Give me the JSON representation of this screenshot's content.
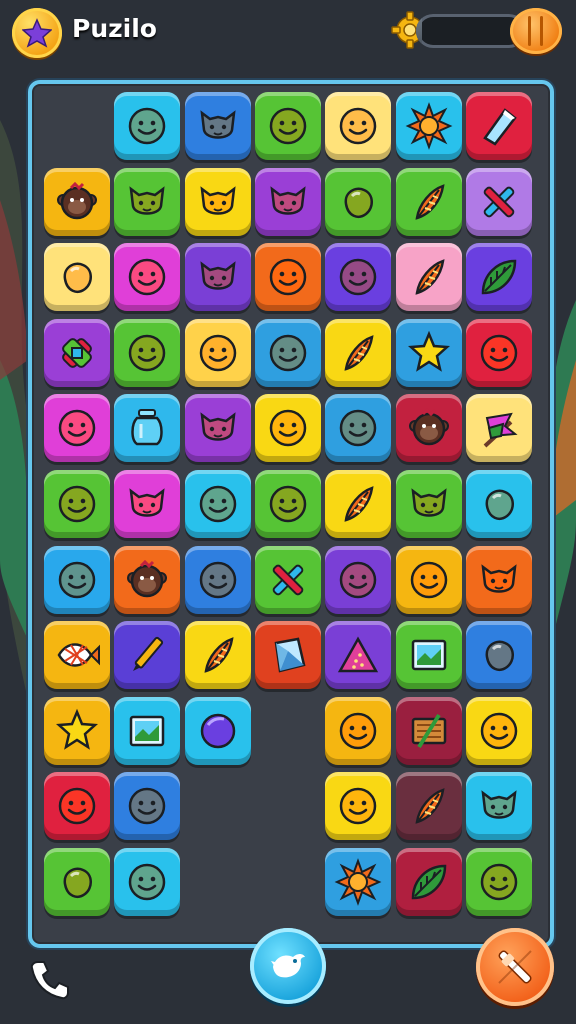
{
  "app": {
    "title": "Puzilo"
  },
  "header": {
    "progress_fraction": 0.05
  },
  "colors": {
    "background": "#2b3038",
    "board_border": "#66c7ee",
    "board_fill": "#3a3f48"
  },
  "bottom_bar": {
    "left_icon": "phone-icon",
    "center_icon": "bird-icon",
    "right_icon": "crossed-tools-icon"
  },
  "board": {
    "columns": 7,
    "rows": 11,
    "tiles": [
      {
        "row": 0,
        "col": 1,
        "color": "#29c1ec",
        "icon": "smiley"
      },
      {
        "row": 0,
        "col": 2,
        "color": "#2f7fe0",
        "icon": "cat"
      },
      {
        "row": 0,
        "col": 3,
        "color": "#56c435",
        "icon": "smiley"
      },
      {
        "row": 0,
        "col": 4,
        "color": "#ffe27a",
        "icon": "smiley"
      },
      {
        "row": 0,
        "col": 5,
        "color": "#29c1ec",
        "icon": "sun"
      },
      {
        "row": 0,
        "col": 6,
        "color": "#e0213f",
        "icon": "crystal"
      },
      {
        "row": 1,
        "col": 0,
        "color": "#f5b611",
        "icon": "monkey"
      },
      {
        "row": 1,
        "col": 1,
        "color": "#56c435",
        "icon": "cat"
      },
      {
        "row": 1,
        "col": 2,
        "color": "#f9d814",
        "icon": "cat"
      },
      {
        "row": 1,
        "col": 3,
        "color": "#9a3fd6",
        "icon": "cat"
      },
      {
        "row": 1,
        "col": 4,
        "color": "#56c435",
        "icon": "blob"
      },
      {
        "row": 1,
        "col": 5,
        "color": "#56c435",
        "icon": "feather"
      },
      {
        "row": 1,
        "col": 6,
        "color": "#b07ae6",
        "icon": "cross"
      },
      {
        "row": 2,
        "col": 0,
        "color": "#ffe27a",
        "icon": "blob"
      },
      {
        "row": 2,
        "col": 1,
        "color": "#e03fd8",
        "icon": "smiley"
      },
      {
        "row": 2,
        "col": 2,
        "color": "#7a3fd6",
        "icon": "cat"
      },
      {
        "row": 2,
        "col": 3,
        "color": "#f26a1b",
        "icon": "smiley"
      },
      {
        "row": 2,
        "col": 4,
        "color": "#6a3fe0",
        "icon": "smiley"
      },
      {
        "row": 2,
        "col": 5,
        "color": "#f7a3c7",
        "icon": "feather"
      },
      {
        "row": 2,
        "col": 6,
        "color": "#6a3fe0",
        "icon": "leaf"
      },
      {
        "row": 3,
        "col": 0,
        "color": "#9a3fd6",
        "icon": "candy"
      },
      {
        "row": 3,
        "col": 1,
        "color": "#56c435",
        "icon": "smiley"
      },
      {
        "row": 3,
        "col": 2,
        "color": "#ffd24a",
        "icon": "smiley"
      },
      {
        "row": 3,
        "col": 3,
        "color": "#2f9fe0",
        "icon": "smiley"
      },
      {
        "row": 3,
        "col": 4,
        "color": "#f9d814",
        "icon": "feather"
      },
      {
        "row": 3,
        "col": 5,
        "color": "#2f9fe0",
        "icon": "star"
      },
      {
        "row": 3,
        "col": 6,
        "color": "#e0213f",
        "icon": "smiley"
      },
      {
        "row": 4,
        "col": 0,
        "color": "#e03fd8",
        "icon": "smiley"
      },
      {
        "row": 4,
        "col": 1,
        "color": "#2fb8ec",
        "icon": "jar"
      },
      {
        "row": 4,
        "col": 2,
        "color": "#9a3fd6",
        "icon": "cat"
      },
      {
        "row": 4,
        "col": 3,
        "color": "#f9d814",
        "icon": "smiley"
      },
      {
        "row": 4,
        "col": 4,
        "color": "#2f9fe0",
        "icon": "smiley"
      },
      {
        "row": 4,
        "col": 5,
        "color": "#c2213f",
        "icon": "monkey"
      },
      {
        "row": 4,
        "col": 6,
        "color": "#ffe27a",
        "icon": "flag"
      },
      {
        "row": 5,
        "col": 0,
        "color": "#56c435",
        "icon": "smiley"
      },
      {
        "row": 5,
        "col": 1,
        "color": "#e03fd8",
        "icon": "cat"
      },
      {
        "row": 5,
        "col": 2,
        "color": "#29c1ec",
        "icon": "smiley"
      },
      {
        "row": 5,
        "col": 3,
        "color": "#56c435",
        "icon": "smiley"
      },
      {
        "row": 5,
        "col": 4,
        "color": "#f9d814",
        "icon": "feather"
      },
      {
        "row": 5,
        "col": 5,
        "color": "#56c435",
        "icon": "cat"
      },
      {
        "row": 5,
        "col": 6,
        "color": "#29c1ec",
        "icon": "blob"
      },
      {
        "row": 6,
        "col": 0,
        "color": "#29a8ec",
        "icon": "smiley"
      },
      {
        "row": 6,
        "col": 1,
        "color": "#f26a1b",
        "icon": "monkey"
      },
      {
        "row": 6,
        "col": 2,
        "color": "#2f7fe0",
        "icon": "smiley"
      },
      {
        "row": 6,
        "col": 3,
        "color": "#56c435",
        "icon": "cross"
      },
      {
        "row": 6,
        "col": 4,
        "color": "#7a3fd6",
        "icon": "smiley"
      },
      {
        "row": 6,
        "col": 5,
        "color": "#f5b611",
        "icon": "smiley"
      },
      {
        "row": 6,
        "col": 6,
        "color": "#f26a1b",
        "icon": "cat"
      },
      {
        "row": 7,
        "col": 0,
        "color": "#f5b611",
        "icon": "fish"
      },
      {
        "row": 7,
        "col": 1,
        "color": "#5a3fd6",
        "icon": "pencil"
      },
      {
        "row": 7,
        "col": 2,
        "color": "#f9d814",
        "icon": "feather"
      },
      {
        "row": 7,
        "col": 3,
        "color": "#e0411f",
        "icon": "gem"
      },
      {
        "row": 7,
        "col": 4,
        "color": "#7a3fd6",
        "icon": "triangle"
      },
      {
        "row": 7,
        "col": 5,
        "color": "#56c435",
        "icon": "picture"
      },
      {
        "row": 7,
        "col": 6,
        "color": "#2f7fe0",
        "icon": "blob"
      },
      {
        "row": 8,
        "col": 0,
        "color": "#f5b611",
        "icon": "star"
      },
      {
        "row": 8,
        "col": 1,
        "color": "#29c1ec",
        "icon": "picture"
      },
      {
        "row": 8,
        "col": 2,
        "color": "#29c1ec",
        "icon": "ball"
      },
      {
        "row": 8,
        "col": 4,
        "color": "#f5b611",
        "icon": "smiley"
      },
      {
        "row": 8,
        "col": 5,
        "color": "#9a1f3f",
        "icon": "sign"
      },
      {
        "row": 8,
        "col": 6,
        "color": "#f9d814",
        "icon": "smiley"
      },
      {
        "row": 9,
        "col": 0,
        "color": "#e0213f",
        "icon": "smiley"
      },
      {
        "row": 9,
        "col": 1,
        "color": "#2f7fe0",
        "icon": "smiley"
      },
      {
        "row": 9,
        "col": 4,
        "color": "#f9d814",
        "icon": "smiley"
      },
      {
        "row": 9,
        "col": 5,
        "color": "#6a2f3f",
        "icon": "feather"
      },
      {
        "row": 9,
        "col": 6,
        "color": "#29c1ec",
        "icon": "cat"
      },
      {
        "row": 10,
        "col": 0,
        "color": "#56c435",
        "icon": "blob"
      },
      {
        "row": 10,
        "col": 1,
        "color": "#29c1ec",
        "icon": "smiley"
      },
      {
        "row": 10,
        "col": 4,
        "color": "#2f9fe0",
        "icon": "sun"
      },
      {
        "row": 10,
        "col": 5,
        "color": "#b01f3f",
        "icon": "leaf"
      },
      {
        "row": 10,
        "col": 6,
        "color": "#56c435",
        "icon": "smiley"
      }
    ]
  }
}
